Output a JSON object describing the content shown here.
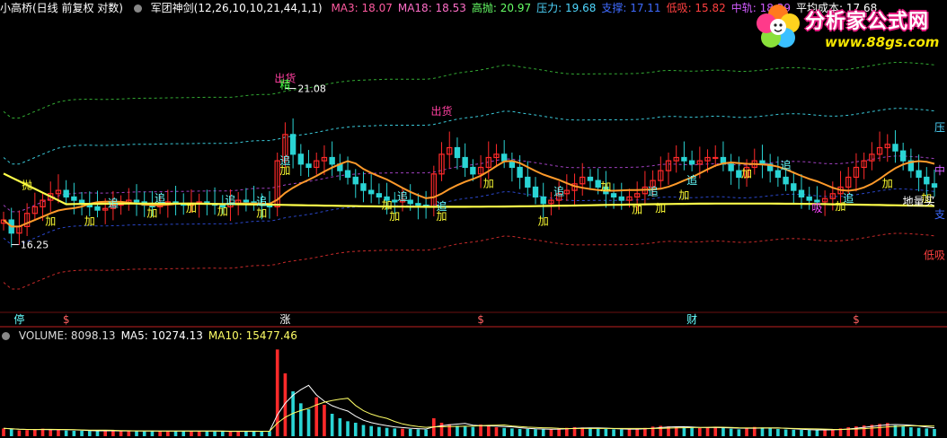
{
  "header": {
    "title": "小高桥(日线 前复权 对数)",
    "indicator": "军团神剑(12,26,10,10,21,44,1,1)",
    "items": [
      {
        "label": "MA3: 18.07",
        "color": "#ff5aa0"
      },
      {
        "label": "MA18: 18.53",
        "color": "#ff6ec7"
      },
      {
        "label": "高抛: 20.97",
        "color": "#66ff66"
      },
      {
        "label": "压力: 19.68",
        "color": "#4fd7ff"
      },
      {
        "label": "支撑: 17.11",
        "color": "#3f6bff"
      },
      {
        "label": "低吸: 15.82",
        "color": "#ff4040"
      },
      {
        "label": "中轨: 18.39",
        "color": "#d25cff"
      },
      {
        "label": "平均成本: 17.68",
        "color": "#ffffff"
      }
    ]
  },
  "volume_header": {
    "items": [
      {
        "label": "VOLUME: 8098.13",
        "color": "#dddddd"
      },
      {
        "label": "MA5: 10274.13",
        "color": "#ffffff"
      },
      {
        "label": "MA10: 15477.46",
        "color": "#ffff66"
      }
    ]
  },
  "watermark": {
    "text": "分析家公式网",
    "url": "www.88gs.com"
  },
  "colors": {
    "up": "#ff2a2a",
    "down": "#2ad4d4",
    "ma_orange": "#ff9a2a",
    "cost_line": "#ffff4a",
    "high_band": "#33aa33",
    "press_band": "#3ac8d8",
    "support_band": "#2a46c8",
    "low_band": "#c82a2a",
    "mid_band": "#a040c0"
  },
  "chart_data": {
    "type": "candlestick",
    "price_high_label": "21.08",
    "price_low_label": "16.25",
    "ylim": [
      15.5,
      22.6
    ],
    "trading_days": 120,
    "signals": [
      {
        "text": "出货",
        "color": "#ff40a0",
        "day": 36,
        "price": 21.2
      },
      {
        "text": "精",
        "color": "#44ff44",
        "day": 36,
        "price": 21.0
      },
      {
        "text": "出货",
        "color": "#ff40a0",
        "day": 56,
        "price": 20.2
      },
      {
        "text": "地量买",
        "color": "#ffffff",
        "day": 117,
        "price": 17.45
      }
    ],
    "markers": [
      {
        "text": "抛",
        "color": "#ffff33",
        "day": 3,
        "price": 17.95
      },
      {
        "text": "加",
        "color": "#ffff33",
        "day": 6,
        "price": 16.85
      },
      {
        "text": "追",
        "color": "#66ffff",
        "day": 14,
        "price": 17.4
      },
      {
        "text": "加",
        "color": "#ffff33",
        "day": 11,
        "price": 16.85
      },
      {
        "text": "加",
        "color": "#ffff33",
        "day": 19,
        "price": 17.1
      },
      {
        "text": "追",
        "color": "#66ffff",
        "day": 20,
        "price": 17.55
      },
      {
        "text": "加",
        "color": "#ffff33",
        "day": 24,
        "price": 17.25
      },
      {
        "text": "追",
        "color": "#66ffff",
        "day": 29,
        "price": 17.5
      },
      {
        "text": "加",
        "color": "#ffff33",
        "day": 28,
        "price": 17.15
      },
      {
        "text": "追",
        "color": "#66ffff",
        "day": 33,
        "price": 17.45
      },
      {
        "text": "加",
        "color": "#ffff33",
        "day": 33,
        "price": 17.1
      },
      {
        "text": "追",
        "color": "#66ffff",
        "day": 36,
        "price": 18.7
      },
      {
        "text": "加",
        "color": "#ffff33",
        "day": 36,
        "price": 18.4
      },
      {
        "text": "加",
        "color": "#ffff33",
        "day": 49,
        "price": 17.35
      },
      {
        "text": "追",
        "color": "#66ffff",
        "day": 51,
        "price": 17.6
      },
      {
        "text": "加",
        "color": "#ffff33",
        "day": 50,
        "price": 17.0
      },
      {
        "text": "追",
        "color": "#66ffff",
        "day": 56,
        "price": 17.3
      },
      {
        "text": "加",
        "color": "#ffff33",
        "day": 56,
        "price": 17.0
      },
      {
        "text": "加",
        "color": "#ffff33",
        "day": 62,
        "price": 18.0
      },
      {
        "text": "加",
        "color": "#ffff33",
        "day": 69,
        "price": 16.85
      },
      {
        "text": "追",
        "color": "#66ffff",
        "day": 71,
        "price": 17.75
      },
      {
        "text": "加",
        "color": "#ffff33",
        "day": 77,
        "price": 17.9
      },
      {
        "text": "加",
        "color": "#ffff33",
        "day": 81,
        "price": 17.2
      },
      {
        "text": "追",
        "color": "#66ffff",
        "day": 83,
        "price": 17.75
      },
      {
        "text": "加",
        "color": "#ffff33",
        "day": 84,
        "price": 17.25
      },
      {
        "text": "追",
        "color": "#66ffff",
        "day": 88,
        "price": 18.1
      },
      {
        "text": "加",
        "color": "#ffff33",
        "day": 87,
        "price": 17.65
      },
      {
        "text": "加",
        "color": "#ffff33",
        "day": 95,
        "price": 18.3
      },
      {
        "text": "追",
        "color": "#66ffff",
        "day": 100,
        "price": 18.55
      },
      {
        "text": "吸",
        "color": "#ff44ff",
        "day": 104,
        "price": 17.25
      },
      {
        "text": "追",
        "color": "#66ffff",
        "day": 108,
        "price": 17.55
      },
      {
        "text": "加",
        "color": "#ffff33",
        "day": 107,
        "price": 17.3
      },
      {
        "text": "加",
        "color": "#ffff33",
        "day": 113,
        "price": 18.0
      },
      {
        "text": "加",
        "color": "#ffff33",
        "day": 118,
        "price": 17.55
      }
    ],
    "band_labels": [
      {
        "text": "压",
        "color": "#4fd7ff",
        "price": 19.7
      },
      {
        "text": "中",
        "color": "#d25cff",
        "price": 18.4
      },
      {
        "text": "支",
        "color": "#3f6bff",
        "price": 17.05
      },
      {
        "text": "低吸",
        "color": "#ff4040",
        "price": 15.82
      }
    ],
    "bottom_tags": [
      {
        "text": "停",
        "color": "#66ffff",
        "day": 2
      },
      {
        "text": "$",
        "color": "#ff6060",
        "day": 8
      },
      {
        "text": "涨",
        "color": "#ffffff",
        "day": 36
      },
      {
        "text": "$",
        "color": "#ff6060",
        "day": 61
      },
      {
        "text": "财",
        "color": "#66ffff",
        "day": 88
      },
      {
        "text": "$",
        "color": "#ff6060",
        "day": 109
      }
    ],
    "price_path": [
      17.0,
      16.6,
      16.8,
      17.2,
      17.4,
      17.6,
      17.8,
      17.9,
      17.7,
      17.6,
      17.5,
      17.4,
      17.3,
      17.35,
      17.45,
      17.5,
      17.6,
      17.55,
      17.45,
      17.4,
      17.5,
      17.55,
      17.5,
      17.45,
      17.5,
      17.55,
      17.5,
      17.45,
      17.4,
      17.5,
      17.6,
      17.55,
      17.5,
      17.45,
      17.4,
      18.8,
      19.6,
      19.0,
      18.7,
      18.6,
      18.8,
      18.9,
      18.7,
      18.5,
      18.3,
      18.1,
      17.9,
      17.8,
      17.7,
      17.6,
      17.55,
      17.6,
      17.5,
      17.45,
      17.4,
      18.4,
      19.0,
      19.2,
      18.9,
      18.6,
      18.4,
      18.6,
      18.9,
      19.0,
      18.8,
      18.6,
      18.3,
      18.0,
      17.7,
      17.5,
      17.6,
      17.8,
      17.9,
      18.1,
      18.3,
      18.2,
      18.0,
      17.8,
      17.7,
      17.6,
      17.7,
      17.8,
      18.0,
      18.2,
      18.5,
      18.8,
      18.9,
      18.8,
      18.7,
      18.8,
      18.9,
      18.9,
      18.7,
      18.5,
      18.3,
      18.6,
      18.8,
      18.7,
      18.5,
      18.3,
      18.1,
      17.9,
      17.7,
      17.6,
      17.55,
      17.65,
      17.8,
      18.0,
      18.3,
      18.6,
      18.8,
      19.0,
      19.2,
      19.3,
      19.1,
      18.8,
      18.5,
      18.3,
      18.1,
      18.0
    ],
    "volume": {
      "ylim": [
        0,
        60000
      ],
      "values": [
        5200,
        4800,
        3900,
        4100,
        4300,
        5000,
        4700,
        4200,
        3800,
        3600,
        3700,
        3500,
        3400,
        3900,
        3600,
        3300,
        3500,
        3400,
        3200,
        3700,
        3500,
        3400,
        3300,
        3600,
        3500,
        3300,
        3400,
        3200,
        3300,
        3100,
        3400,
        3300,
        3200,
        3500,
        3400,
        58000,
        42000,
        30000,
        22000,
        18000,
        26000,
        21000,
        15000,
        12000,
        10000,
        9000,
        7500,
        6800,
        6200,
        5600,
        5200,
        5000,
        4800,
        4600,
        4400,
        12000,
        9000,
        8000,
        7000,
        6500,
        6200,
        7800,
        7000,
        6000,
        5500,
        5200,
        4900,
        4800,
        4600,
        4500,
        4700,
        5200,
        5600,
        6100,
        5800,
        5300,
        5000,
        4800,
        4600,
        4500,
        4700,
        5200,
        5500,
        6400,
        6900,
        6600,
        6100,
        5800,
        5600,
        5400,
        5800,
        6200,
        5400,
        5000,
        4600,
        5600,
        6200,
        5800,
        5200,
        4800,
        4500,
        4300,
        4200,
        4100,
        4000,
        4300,
        4600,
        5200,
        6000,
        6600,
        7200,
        7600,
        8200,
        8800,
        7200,
        6600,
        6000,
        5600,
        5200,
        4800
      ]
    }
  }
}
